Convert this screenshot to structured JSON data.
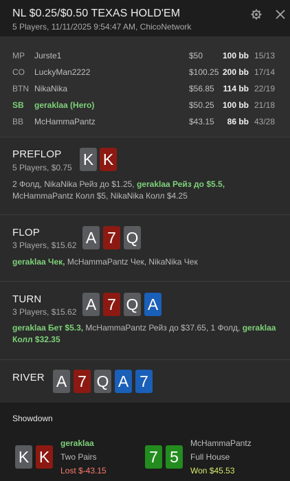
{
  "header": {
    "title": "NL $0.25/$0.50 TEXAS HOLD'EM",
    "subtitle": "5 Players, 11/11/2025 9:54:47 AM, ChicoNetwork",
    "gear_icon": "gear-icon",
    "close_icon": "close-icon"
  },
  "players": [
    {
      "pos": "MP",
      "name": "Jurste1",
      "stack": "$50",
      "bb": "100 bb",
      "ratio": "15/13",
      "hero": false
    },
    {
      "pos": "CO",
      "name": "LuckyMan2222",
      "stack": "$100.25",
      "bb": "200 bb",
      "ratio": "17/14",
      "hero": false
    },
    {
      "pos": "BTN",
      "name": "NikaNika",
      "stack": "$56.85",
      "bb": "114 bb",
      "ratio": "22/19",
      "hero": false
    },
    {
      "pos": "SB",
      "name": "geraklaa (Hero)",
      "stack": "$50.25",
      "bb": "100 bb",
      "ratio": "21/18",
      "hero": true
    },
    {
      "pos": "BB",
      "name": "McHammaPantz",
      "stack": "$43.15",
      "bb": "86 bb",
      "ratio": "43/28",
      "hero": false
    }
  ],
  "preflop": {
    "label": "PREFLOP",
    "info": "5 Players, $0.75",
    "cards": [
      "K",
      "K"
    ],
    "action_a": "2 Фолд, NikaNika Рейз до $1.25, ",
    "action_hero": "geraklaa Рейз до $5.5,",
    "action_b": " McHammaPantz Колл $5, NikaNika Колл $4.25"
  },
  "flop": {
    "label": "FLOP",
    "info": "3 Players, $15.62",
    "cards": [
      "A",
      "7",
      "Q"
    ],
    "action_hero": "geraklaa Чек,",
    "action_b": " McHammaPantz Чек, NikaNika Чек"
  },
  "turn": {
    "label": "TURN",
    "info": "3 Players, $15.62",
    "cards": [
      "A",
      "7",
      "Q",
      "A"
    ],
    "action_hero": "geraklaa Бет $5.3,",
    "action_b": " McHammaPantz Рейз до $37.65, 1 Фолд, ",
    "action_hero2": "geraklaa Колл $32.35"
  },
  "river": {
    "label": "RIVER",
    "cards": [
      "A",
      "7",
      "Q",
      "A",
      "7"
    ]
  },
  "showdown": {
    "title": "Showdown",
    "hero": {
      "name": "geraklaa",
      "hand": "Two Pairs",
      "result": "Lost $-43.15",
      "cards": [
        "K",
        "K"
      ]
    },
    "villain": {
      "name": "McHammaPantz",
      "hand": "Full House",
      "result": "Won $45.53",
      "cards": [
        "7",
        "5"
      ]
    }
  },
  "colors": {
    "hero_green": "#7fd17a",
    "card_grey": "#5a5b5e",
    "card_red": "#8c1a12",
    "card_blue": "#1a5fb8",
    "card_green": "#238c1f",
    "loss": "#ff7a6e",
    "win": "#d9e86b"
  }
}
